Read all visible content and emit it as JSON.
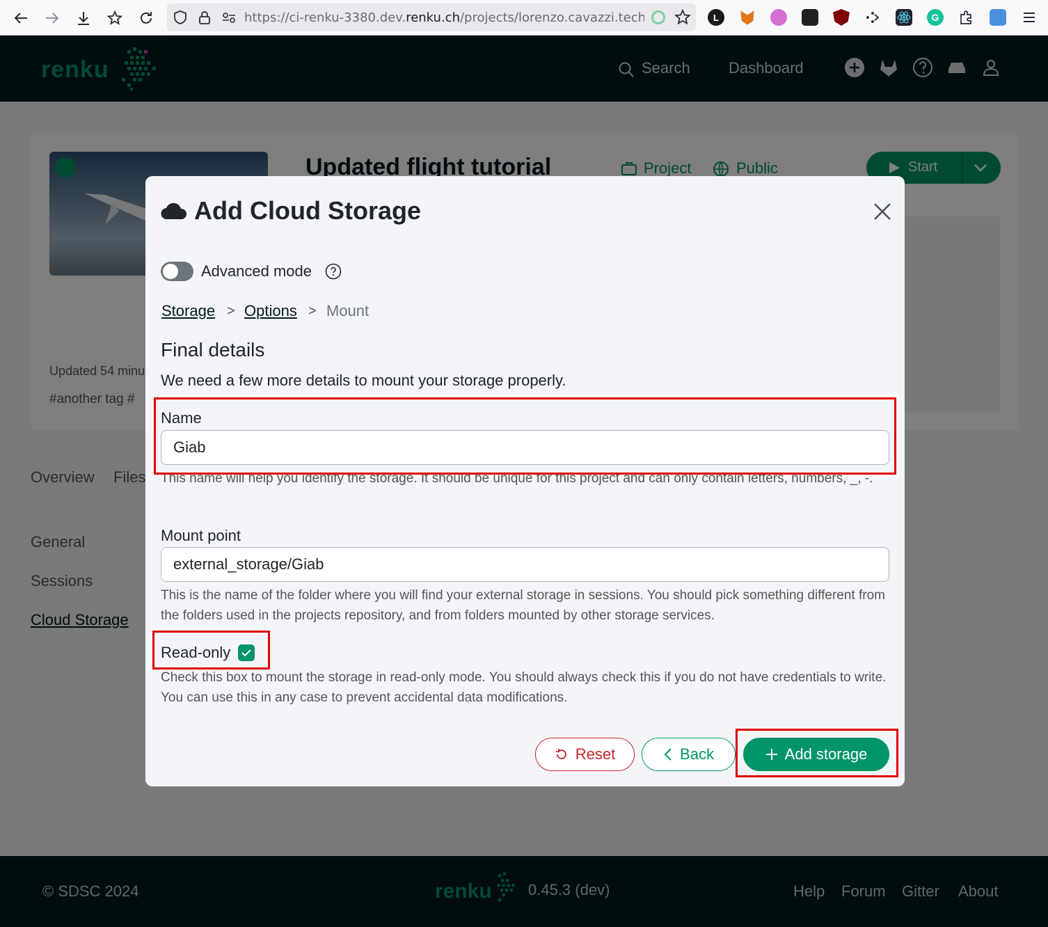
{
  "browser": {
    "url_prefix": "https://ci-renku-3380.dev.",
    "url_domain": "renku.ch",
    "url_path": "/projects/lorenzo.cavazzi.tech/upda"
  },
  "header": {
    "logo": "renku",
    "search": "Search",
    "dashboard": "Dashboard"
  },
  "project": {
    "title": "Updated flight tutorial",
    "type_label": "Project",
    "visibility": "Public",
    "start_label": "Start",
    "updated": "Updated 54 minu",
    "tags": "#another tag  #",
    "tabs": [
      "Overview",
      "Files"
    ],
    "settings_nav": [
      "General",
      "Sessions",
      "Cloud Storage"
    ]
  },
  "modal": {
    "title": "Add Cloud Storage",
    "advanced_mode_label": "Advanced mode",
    "breadcrumb": {
      "storage": "Storage",
      "options": "Options",
      "mount": "Mount",
      "separator": ">"
    },
    "section_title": "Final details",
    "section_desc": "We need a few more details to mount your storage properly.",
    "name": {
      "label": "Name",
      "value": "Giab",
      "help": "This name will help you identify the storage. It should be unique for this project and can only contain letters, numbers, _, -."
    },
    "mount_point": {
      "label": "Mount point",
      "value": "external_storage/Giab",
      "help": "This is the name of the folder where you will find your external storage in sessions. You should pick something different from the folders used in the projects repository, and from folders mounted by other storage services."
    },
    "read_only": {
      "label": "Read-only",
      "checked": true,
      "help": "Check this box to mount the storage in read-only mode. You should always check this if you do not have credentials to write. You can use this in any case to prevent accidental data modifications."
    },
    "buttons": {
      "reset": "Reset",
      "back": "Back",
      "add": "Add storage"
    }
  },
  "footer": {
    "copyright": "© SDSC 2024",
    "version": "0.45.3 (dev)",
    "links": [
      "Help",
      "Forum",
      "Gitter",
      "About"
    ]
  },
  "colors": {
    "brand_green": "#009568",
    "header_bg": "#01191d",
    "danger": "#c5252d",
    "highlight": "#e00000"
  }
}
